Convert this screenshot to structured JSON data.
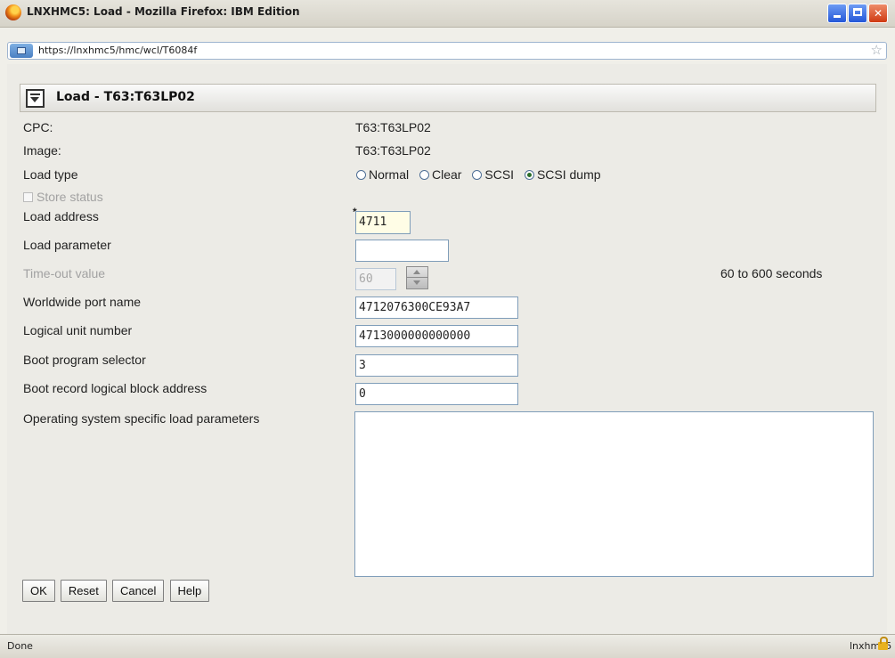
{
  "window": {
    "title": "LNXHMC5: Load - Mozilla Firefox: IBM Edition",
    "url": "https://lnxhmc5/hmc/wcl/T6084f"
  },
  "panel": {
    "title": "Load - T63:T63LP02"
  },
  "form": {
    "cpc": {
      "label": "CPC:",
      "value": "T63:T63LP02"
    },
    "image": {
      "label": "Image:",
      "value": "T63:T63LP02"
    },
    "load_type": {
      "label": "Load type",
      "options": [
        "Normal",
        "Clear",
        "SCSI",
        "SCSI dump"
      ],
      "selected": "SCSI dump"
    },
    "store_status": {
      "label": "Store status",
      "checked": false,
      "enabled": false
    },
    "load_address": {
      "label": "Load address",
      "value": "4711",
      "required_mark": "*"
    },
    "load_parameter": {
      "label": "Load parameter",
      "value": ""
    },
    "timeout": {
      "label": "Time-out value",
      "value": "60",
      "hint": "60 to 600 seconds"
    },
    "wwpn": {
      "label": "Worldwide port name",
      "value": "4712076300CE93A7"
    },
    "lun": {
      "label": "Logical unit number",
      "value": "4713000000000000"
    },
    "boot_program_selector": {
      "label": "Boot program selector",
      "value": "3"
    },
    "boot_record_lba": {
      "label": "Boot record logical block address",
      "value": "0"
    },
    "os_load_params": {
      "label": "Operating system specific load parameters",
      "value": ""
    }
  },
  "buttons": {
    "ok": "OK",
    "reset": "Reset",
    "cancel": "Cancel",
    "help": "Help"
  },
  "status": {
    "text": "Done",
    "host": "lnxhmc5"
  },
  "colors": {
    "titlebar": "#d6d3c8",
    "content_bg": "#ecebe6",
    "field_border": "#7f9db9",
    "close_button": "#cf3a12"
  }
}
